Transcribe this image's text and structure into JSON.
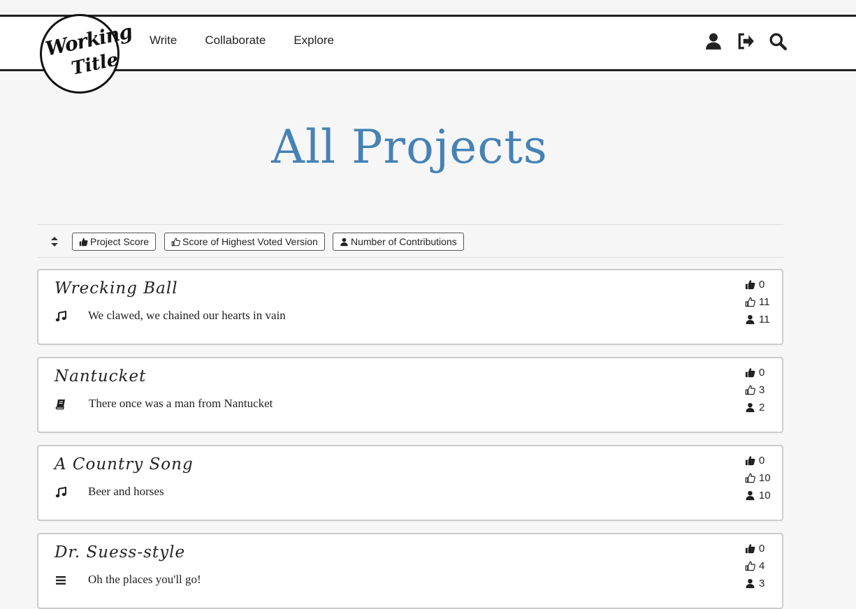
{
  "logo": {
    "line1": "Working",
    "line2": "Title"
  },
  "nav": {
    "links": [
      "Write",
      "Collaborate",
      "Explore"
    ],
    "icons": [
      "user-icon",
      "sign-out-icon",
      "search-icon"
    ]
  },
  "page_title": "All Projects",
  "sort": {
    "toggle_icon": "sort-icon",
    "buttons": [
      {
        "label": "Project Score",
        "icon": "thumbs-up-solid-icon"
      },
      {
        "label": "Score of Highest Voted Version",
        "icon": "thumbs-up-outline-icon"
      },
      {
        "label": "Number of Contributions",
        "icon": "user-icon"
      }
    ]
  },
  "projects": [
    {
      "title": "Wrecking Ball",
      "type_icon": "music-icon",
      "text": "We clawed, we chained our hearts in vain",
      "score": "0",
      "best_version": "11",
      "contributions": "11"
    },
    {
      "title": "Nantucket",
      "type_icon": "book-icon",
      "text": "There once was a man from Nantucket",
      "score": "0",
      "best_version": "3",
      "contributions": "2"
    },
    {
      "title": "A Country Song",
      "type_icon": "music-icon",
      "text": "Beer and horses",
      "score": "0",
      "best_version": "10",
      "contributions": "10"
    },
    {
      "title": "Dr. Suess-style",
      "type_icon": "list-icon",
      "text": "Oh the places you'll go!",
      "score": "0",
      "best_version": "4",
      "contributions": "3"
    }
  ]
}
